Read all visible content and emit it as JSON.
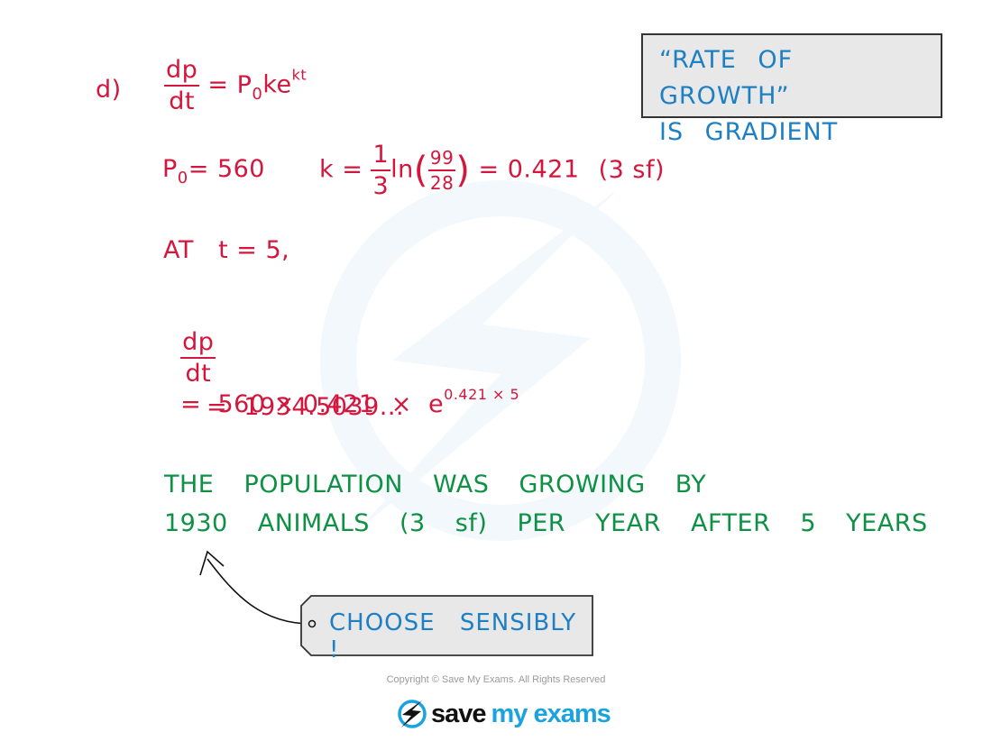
{
  "part_label": "d)",
  "line1": {
    "lhs_num": "dp",
    "lhs_den": "dt",
    "eq": "=",
    "rhs_base": "P",
    "rhs_sub": "0",
    "rhs_mid": "ke",
    "rhs_sup": "kt"
  },
  "line2": {
    "p0_base": "P",
    "p0_sub": "0",
    "p0_rest": "= 560",
    "k_lhs": "k =",
    "k_frac_num": "1",
    "k_frac_den": "3",
    "k_ln": "ln",
    "k_inner_num": "99",
    "k_inner_den": "28",
    "k_result": "= 0.421",
    "k_note": "(3 sf)"
  },
  "line3": {
    "text": "AT   t = 5,"
  },
  "line4": {
    "lhs_num": "dp",
    "lhs_den": "dt",
    "rhs": "=  560 × 0.421  ×  e",
    "rhs_sup": "0.421 × 5"
  },
  "line5": {
    "text": "=  1934.5039..."
  },
  "conclusion": {
    "line1": "THE POPULATION WAS GROWING BY",
    "line2": "1930 ANIMALS (3 sf) PER YEAR AFTER 5 YEARS"
  },
  "note_box": {
    "line1": "“RATE OF GROWTH”",
    "line2": "IS GRADIENT"
  },
  "tag": {
    "text": "CHOOSE SENSIBLY !"
  },
  "footer": {
    "copyright": "Copyright © Save My Exams. All Rights Reserved",
    "logo_word1": "save",
    "logo_word2": "my exams"
  },
  "colors": {
    "working": "#d4163c",
    "conclusion": "#0e9144",
    "annotation": "#1d7fc4",
    "brand": "#1aa3df"
  }
}
